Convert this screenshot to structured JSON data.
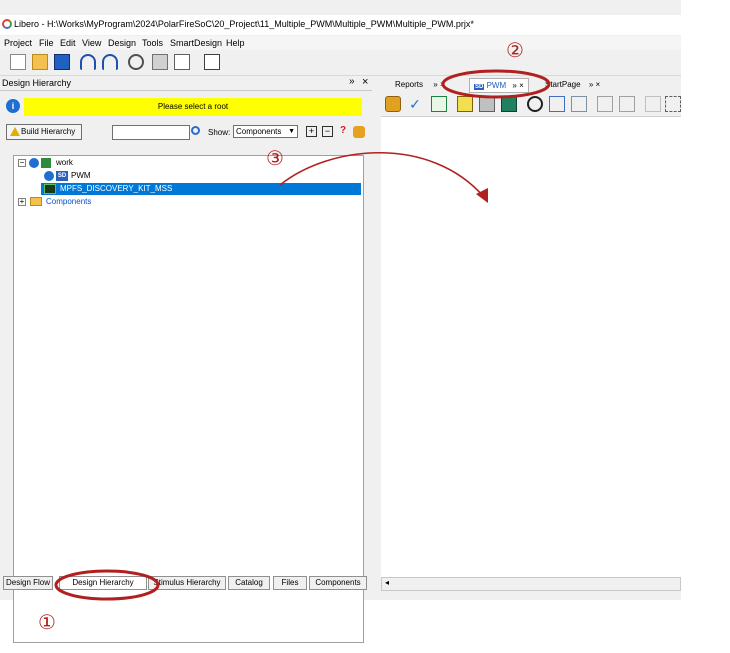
{
  "window": {
    "title": "Libero - H:\\Works\\MyProgram\\2024\\PolarFireSoC\\20_Project\\11_Multiple_PWM\\Multiple_PWM\\Multiple_PWM.prjx*"
  },
  "menu": [
    "Project",
    "File",
    "Edit",
    "View",
    "Design",
    "Tools",
    "SmartDesign",
    "Help"
  ],
  "left_panel": {
    "title": "Design Hierarchy",
    "float_glyph": "»",
    "close_glyph": "×",
    "banner": "Please select a root",
    "build_button": "Build Hierarchy",
    "search_placeholder": "",
    "show_label": "Show:",
    "show_value": "Components",
    "expand_glyph": "+",
    "collapse_glyph": "−",
    "help_glyph": "?",
    "tree": {
      "root": "work",
      "children": [
        "PWM",
        "MPFS_DISCOVERY_KIT_MSS"
      ],
      "components": "Components",
      "minus": "−",
      "plus": "+"
    },
    "bottom_tabs": [
      "Design Flow",
      "Design Hierarchy",
      "Stimulus Hierarchy",
      "Catalog",
      "Files",
      "Components"
    ]
  },
  "right_panel": {
    "tabs": [
      "Reports",
      "PWM",
      "StartPage"
    ],
    "sd_badge": "SD",
    "tab_close": "×",
    "tab_float": "»"
  },
  "annotations": {
    "one": "①",
    "two": "②",
    "three": "③"
  },
  "colors": {
    "selection": "#0078d7",
    "banner": "#ffff00",
    "annotation": "#b02020",
    "link": "#0055cc"
  }
}
